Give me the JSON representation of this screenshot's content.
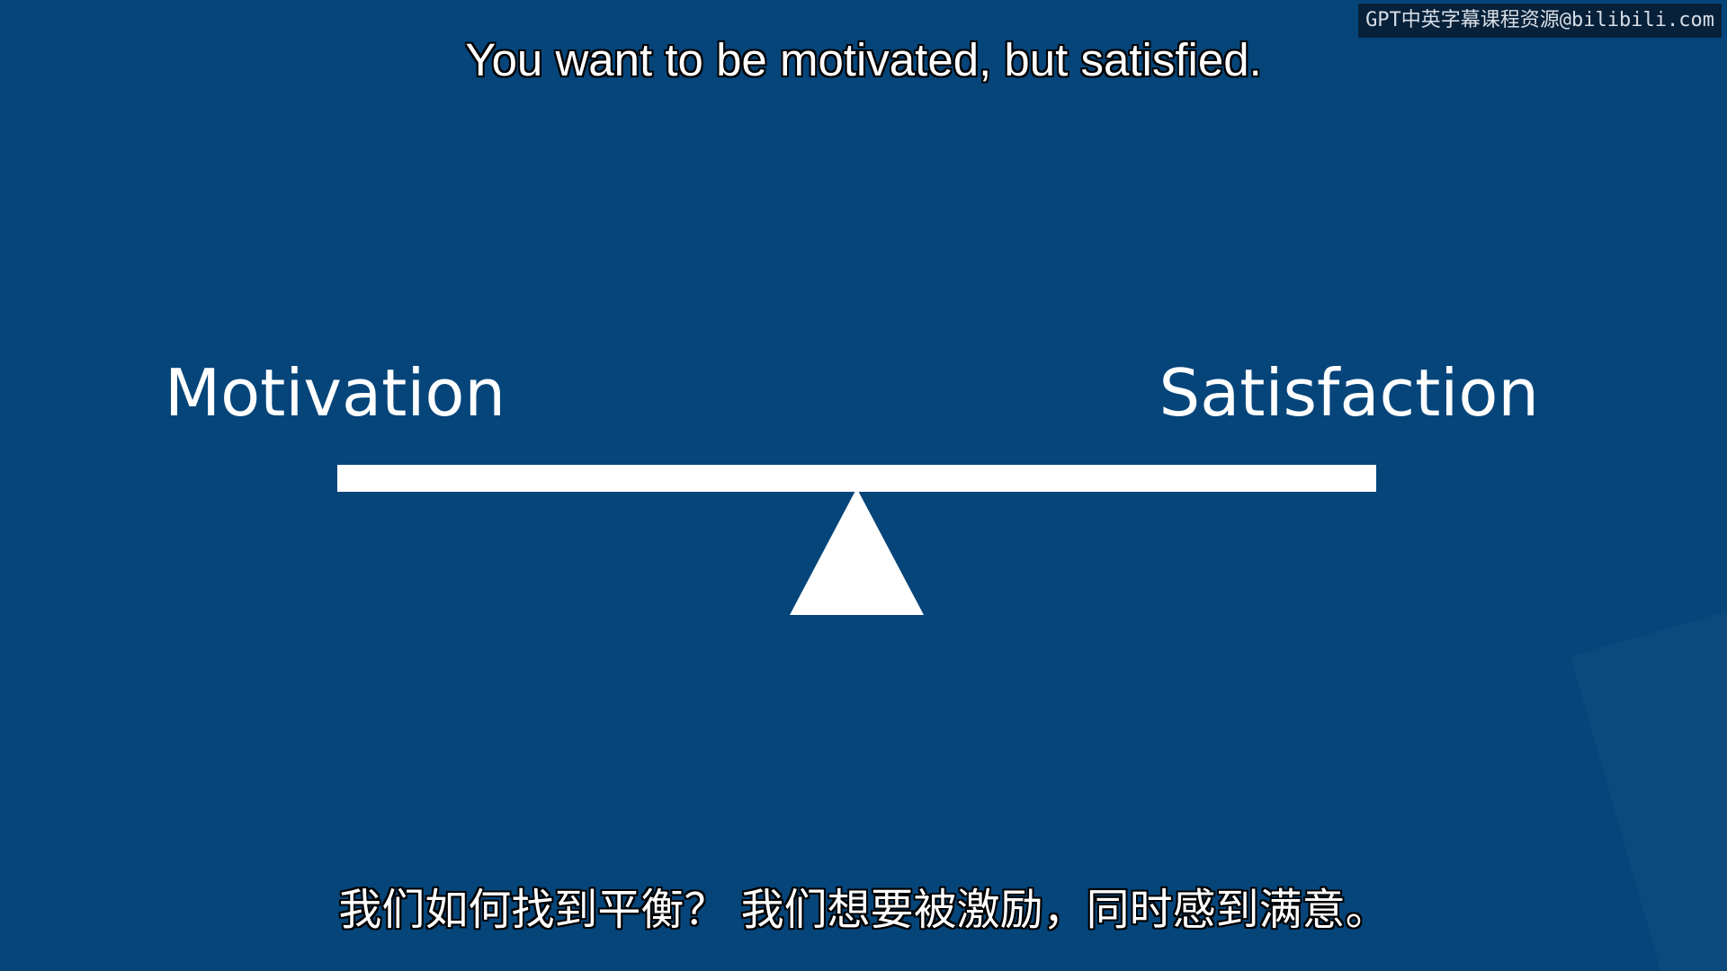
{
  "watermark": "GPT中英字幕课程资源@bilibili.com",
  "subtitle_en": "You want to be motivated, but satisfied.",
  "subtitle_zh": "我们如何找到平衡？ 我们想要被激励，同时感到满意。",
  "slide": {
    "left_label": "Motivation",
    "right_label": "Satisfaction"
  },
  "colors": {
    "background": "#05457a",
    "foreground": "#ffffff"
  }
}
